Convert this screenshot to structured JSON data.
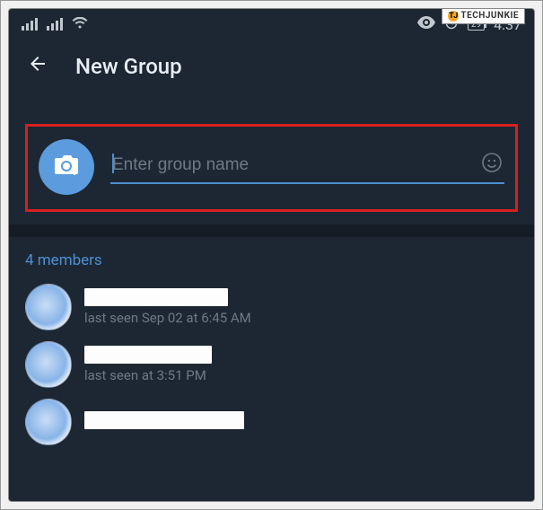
{
  "watermark": "TECHJUNKIE",
  "statusbar": {
    "battery": "29",
    "time": "4:37"
  },
  "header": {
    "title": "New Group"
  },
  "groupName": {
    "placeholder": "Enter group name",
    "value": ""
  },
  "membersLabel": "4 members",
  "members": [
    {
      "lastSeen": "last seen Sep 02 at 6:45 AM",
      "nameRedactWidth": 160
    },
    {
      "lastSeen": "last seen at 3:51 PM",
      "nameRedactWidth": 142
    },
    {
      "lastSeen": "",
      "nameRedactWidth": 178
    }
  ]
}
